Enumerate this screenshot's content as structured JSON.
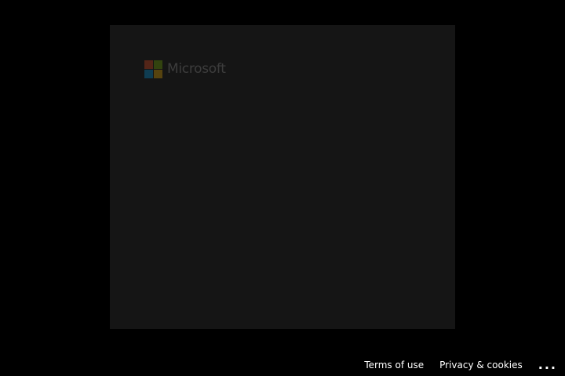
{
  "logo": {
    "text": "Microsoft",
    "icon": "microsoft-logo-icon",
    "colors": {
      "red": "#f25022",
      "green": "#7fba00",
      "blue": "#00a4ef",
      "yellow": "#ffb900"
    }
  },
  "footer": {
    "terms_label": "Terms of use",
    "privacy_label": "Privacy & cookies",
    "more_label": "...",
    "more_icon": "ellipsis-icon"
  },
  "colors": {
    "background": "#000000",
    "card": "#151515",
    "footer_text": "#ffffff"
  }
}
